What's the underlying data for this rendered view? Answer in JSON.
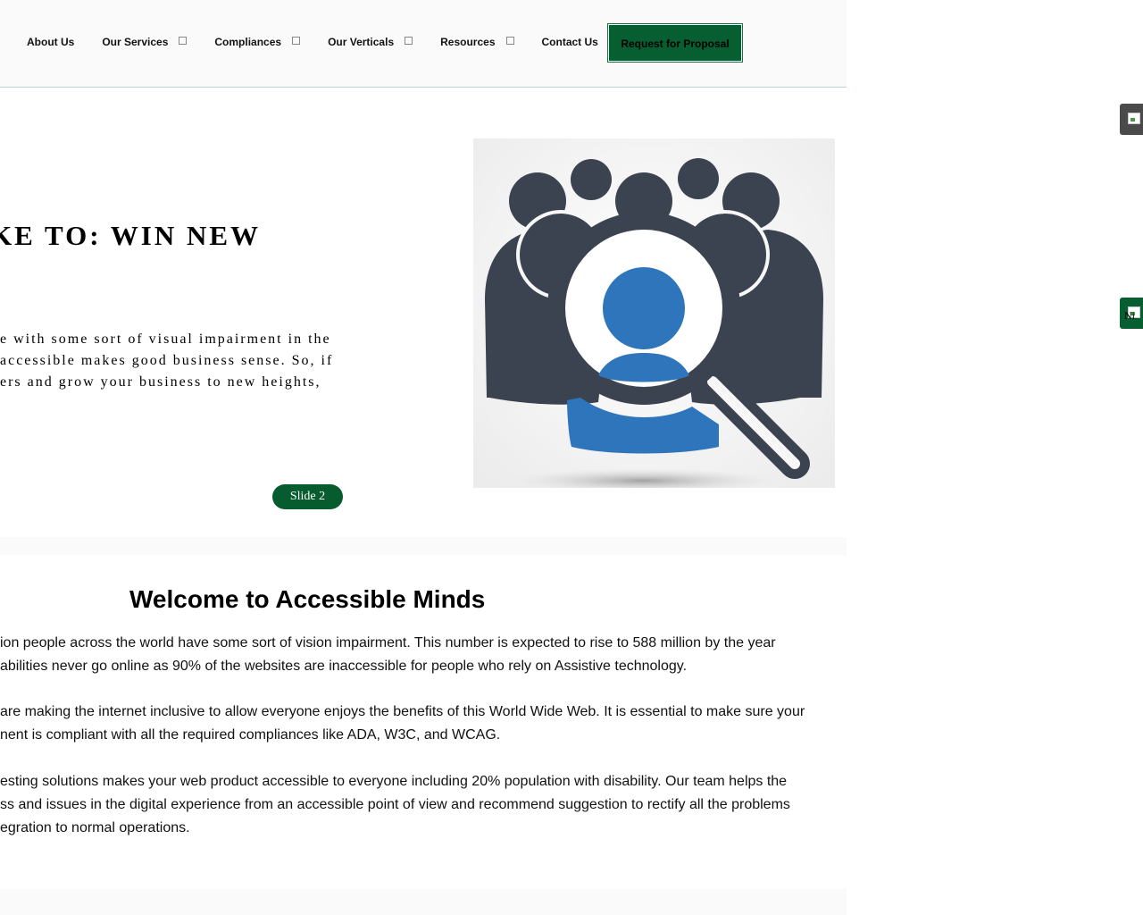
{
  "nav": {
    "items": [
      {
        "label": "About Us",
        "dropdown": false
      },
      {
        "label": "Our Services",
        "dropdown": true
      },
      {
        "label": "Compliances",
        "dropdown": true
      },
      {
        "label": "Our Verticals",
        "dropdown": true
      },
      {
        "label": "Resources",
        "dropdown": true
      },
      {
        "label": "Contact Us",
        "dropdown": false
      }
    ],
    "cta_label": "Request for Proposal"
  },
  "slider": {
    "heading": "IKE TO: WIN NEW",
    "text_lines": [
      "e with some sort of visual impairment in the",
      "accessible makes good business sense. So, if",
      "ers and grow your business to new heights,"
    ],
    "slide_label": "Slide 2",
    "image_icon": "people-magnifier-icon"
  },
  "welcome": {
    "title": "Welcome to Accessible Minds",
    "paragraphs": [
      [
        "ion people across the world have some sort of vision impairment. This number is expected to rise to 588 million by the year",
        "abilities never go online as 90% of the websites are inaccessible for people who rely on Assistive technology."
      ],
      [
        "are making the internet inclusive to allow everyone enjoys the benefits of this World Wide Web. It is essential to make sure your",
        "nent is compliant with all the required compliances like ADA, W3C, and WCAG."
      ],
      [
        "esting solutions makes your web product accessible to everyone including 20% population with disability. Our team helps the",
        "ss and issues in the digital experience from an accessible point of view and recommend suggestion to rectify all the problems",
        "egration to normal operations."
      ]
    ]
  },
  "side_tabs": {
    "top_icon": "broken-image-icon",
    "bottom_text": "Ni"
  },
  "colors": {
    "brand_green": "#075e30",
    "icon_dark": "#3c4350",
    "icon_blue": "#2e75bc"
  }
}
